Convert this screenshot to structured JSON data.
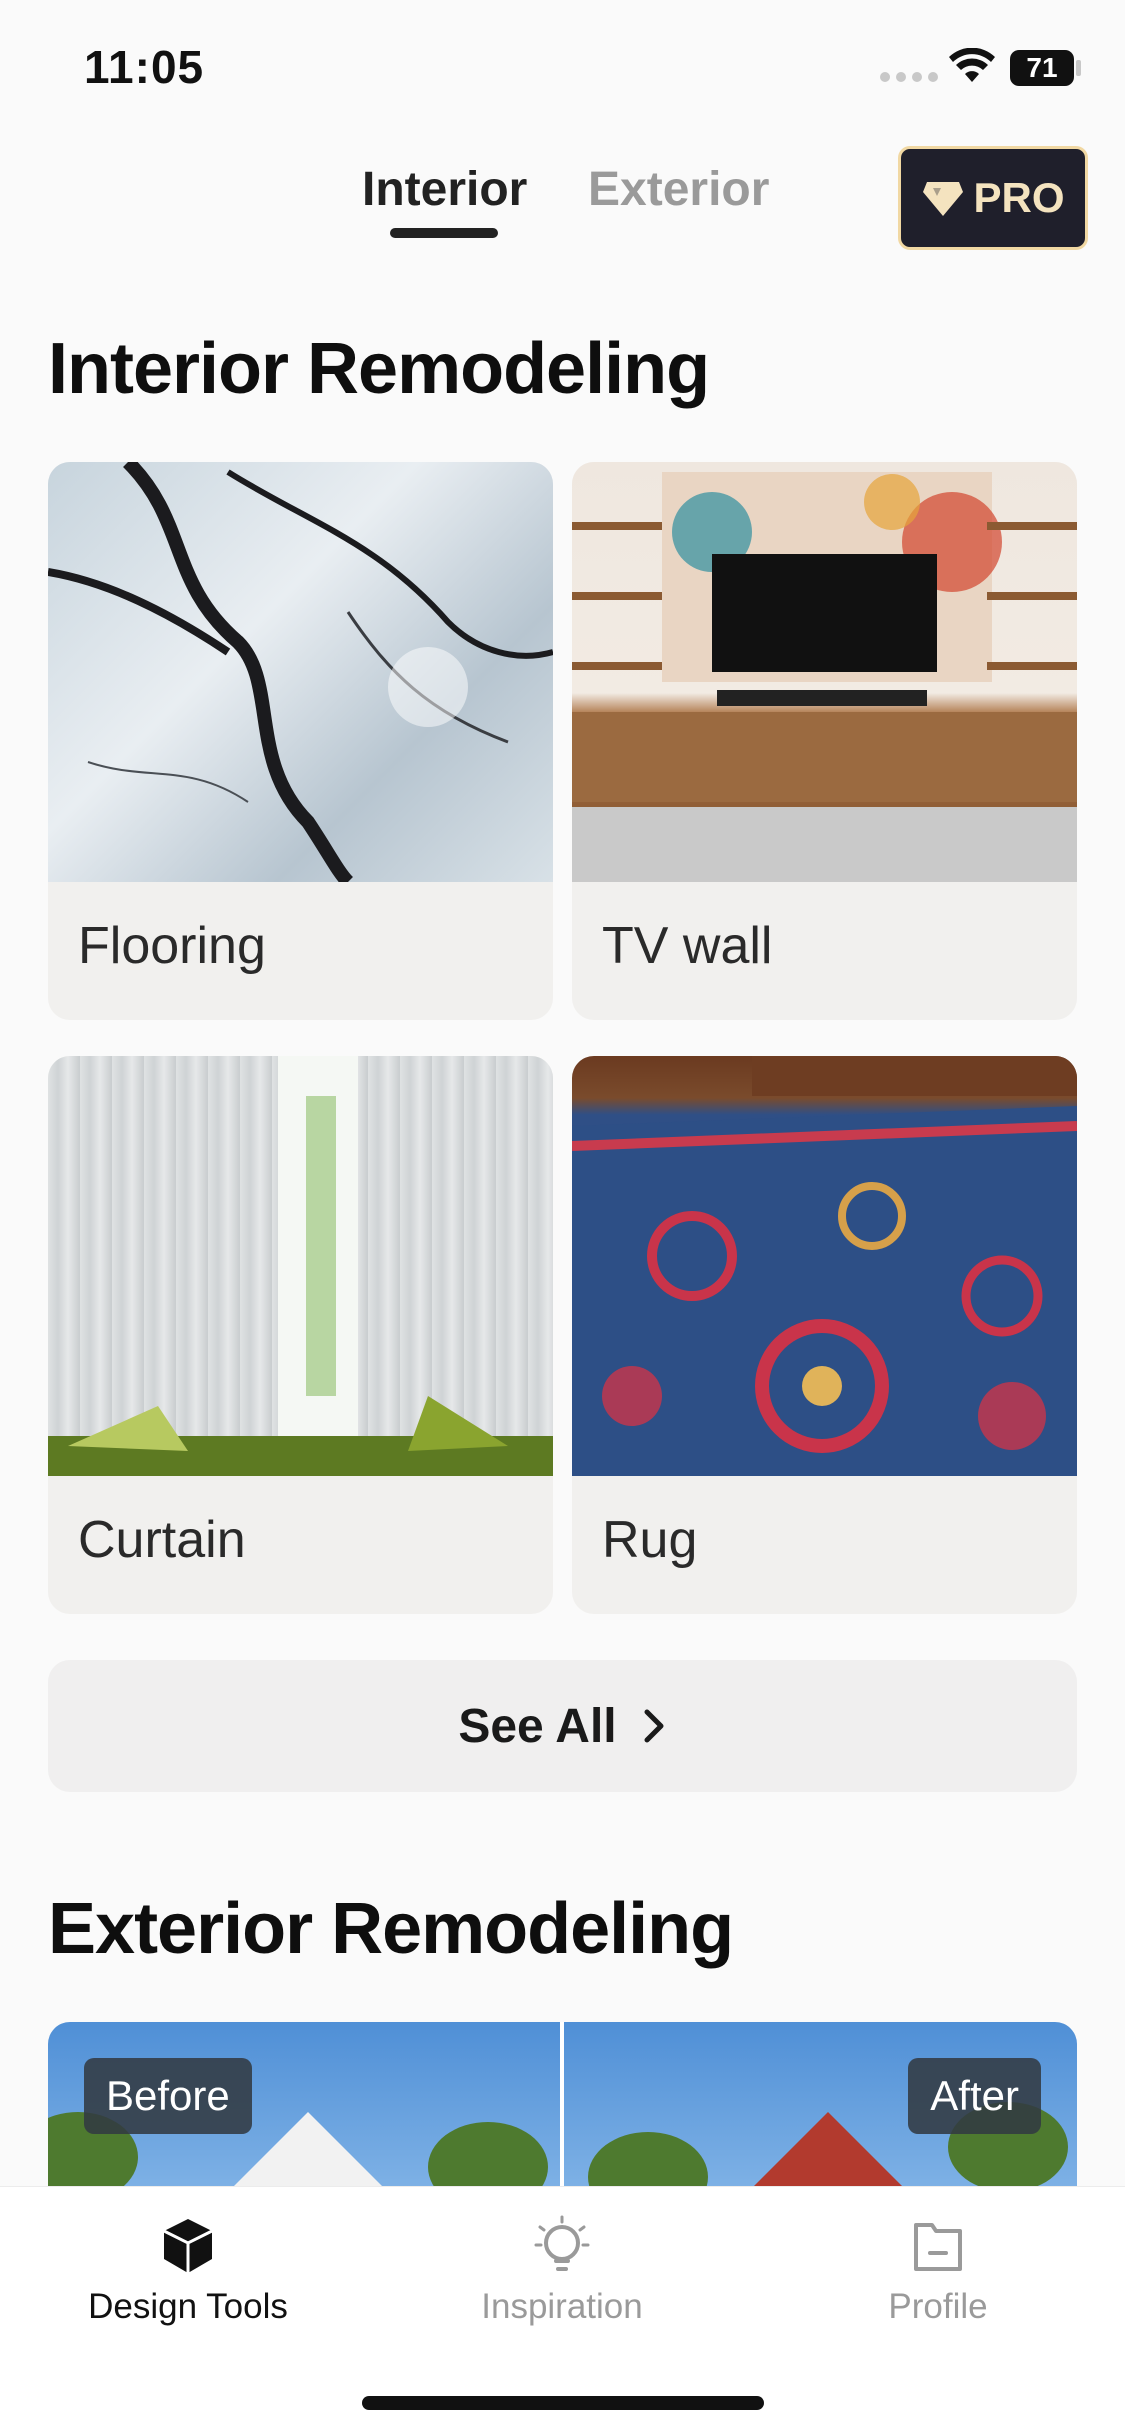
{
  "status_bar": {
    "time": "11:05",
    "battery": "71"
  },
  "top_tabs": [
    {
      "label": "Interior",
      "active": true
    },
    {
      "label": "Exterior",
      "active": false
    }
  ],
  "pro_button": {
    "label": "PRO",
    "icon": "diamond-icon",
    "border_color": "#f1d8a3",
    "bg_color": "#1f1f2b"
  },
  "interior": {
    "title": "Interior Remodeling",
    "cards": [
      {
        "label": "Flooring",
        "image": "marble-floor-image"
      },
      {
        "label": "TV wall",
        "image": "tv-wall-image"
      },
      {
        "label": "Curtain",
        "image": "curtain-image"
      },
      {
        "label": "Rug",
        "image": "rug-image"
      }
    ],
    "see_all": "See All"
  },
  "exterior": {
    "title": "Exterior Remodeling",
    "before_label": "Before",
    "after_label": "After"
  },
  "bottom_nav": [
    {
      "label": "Design Tools",
      "icon": "cube-icon",
      "active": true
    },
    {
      "label": "Inspiration",
      "icon": "lightbulb-icon",
      "active": false
    },
    {
      "label": "Profile",
      "icon": "folder-icon",
      "active": false
    }
  ]
}
